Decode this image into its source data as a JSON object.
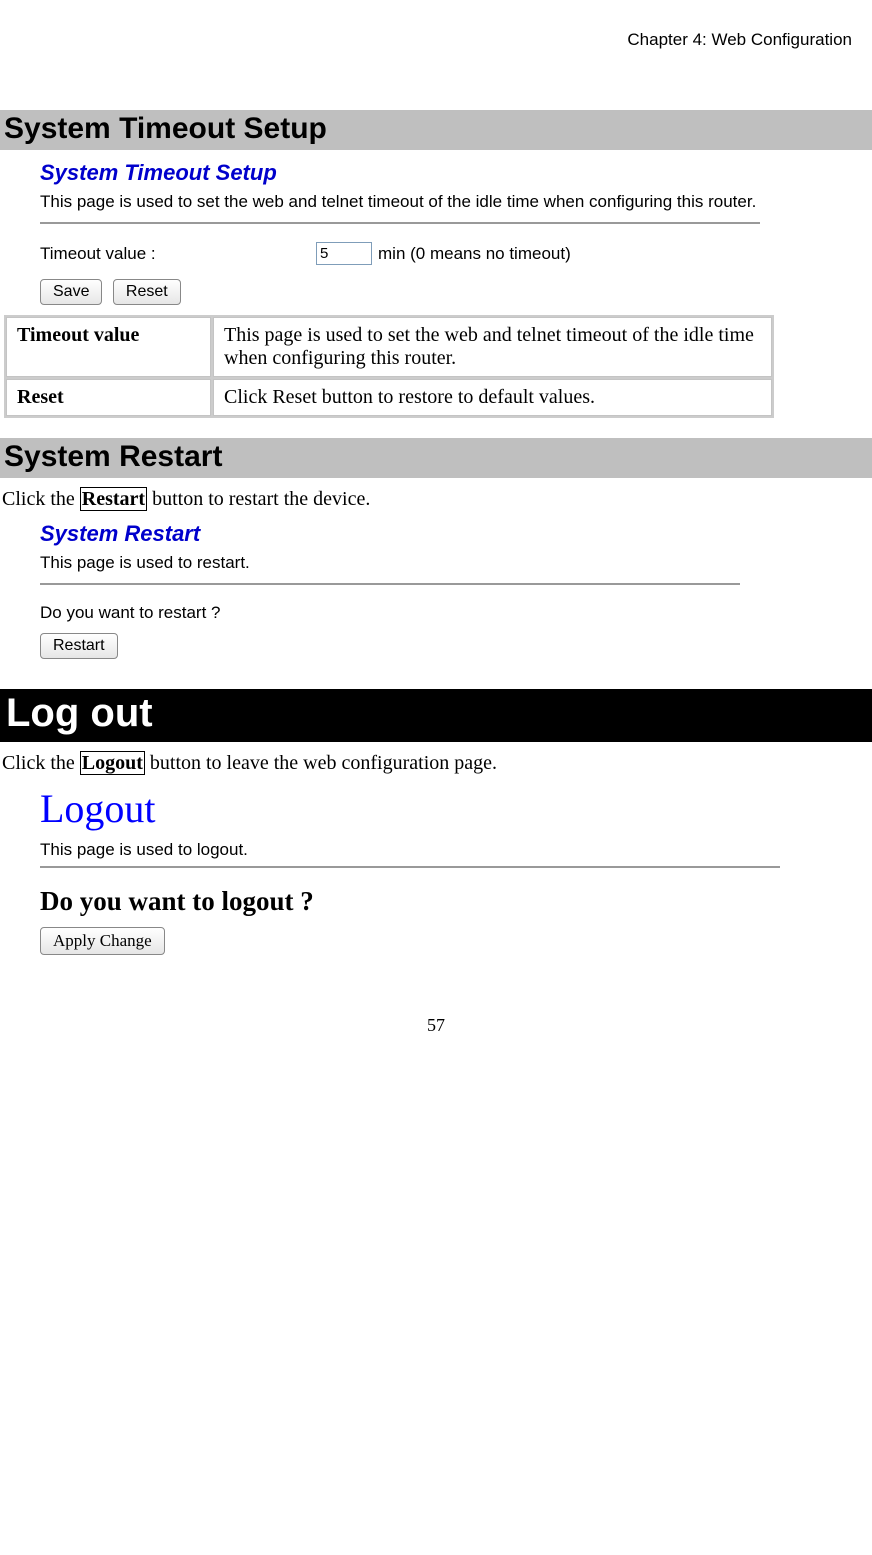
{
  "header": {
    "chapter": "Chapter 4: Web Configuration"
  },
  "sections": {
    "timeout": {
      "heading": "System Timeout Setup",
      "ss_title": "System Timeout Setup",
      "ss_desc": "This page is used to set the web and telnet timeout of the idle time when configuring this router.",
      "label": "Timeout value :",
      "input_value": "5",
      "hint": "min (0 means no timeout)",
      "save_btn": "Save",
      "reset_btn": "Reset",
      "table": {
        "row1_key": "Timeout value",
        "row1_val": "This page is used to set the web and telnet timeout of the idle time when configuring this router.",
        "row2_key": "Reset",
        "row2_val": "Click Reset button to restore to default values."
      }
    },
    "restart": {
      "heading": "System Restart",
      "intro_pre": "Click the ",
      "intro_btn": "Restart",
      "intro_post": " button to restart the device.",
      "ss_title": "System Restart",
      "ss_desc": "This page is used to restart.",
      "question": "Do you want to restart ?",
      "restart_btn": "Restart"
    },
    "logout": {
      "heading": "Log out",
      "intro_pre": "Click the ",
      "intro_btn": "Logout",
      "intro_post": " button to leave the web configuration page.",
      "ss_title": "Logout",
      "ss_desc": "This page is used to logout.",
      "question": "Do you want to logout ?",
      "apply_btn": "Apply Change"
    }
  },
  "page_number": "57"
}
